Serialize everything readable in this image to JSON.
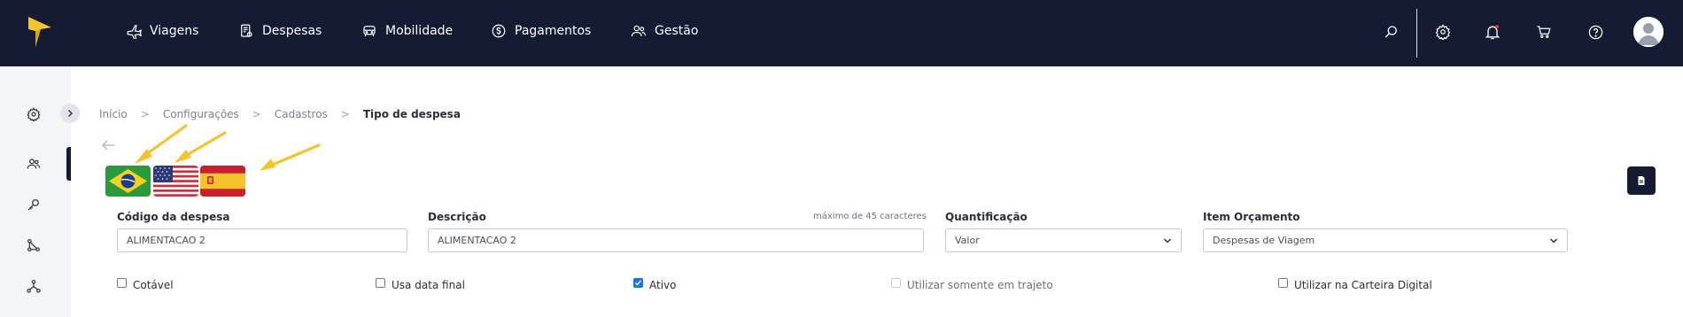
{
  "nav": {
    "items": [
      {
        "label": "Viagens",
        "icon": "airplane-icon"
      },
      {
        "label": "Despesas",
        "icon": "receipt-icon"
      },
      {
        "label": "Mobilidade",
        "icon": "car-icon"
      },
      {
        "label": "Pagamentos",
        "icon": "dollar-coin-icon"
      },
      {
        "label": "Gestão",
        "icon": "users-icon"
      }
    ],
    "right_icons": [
      "search-icon",
      "gear-icon",
      "bell-icon",
      "cart-icon",
      "help-icon",
      "avatar"
    ],
    "notification_dot_color": "#e53935"
  },
  "rail": {
    "icons": [
      "gear-icon",
      "users-icon",
      "key-icon",
      "flow-icon",
      "hierarchy-icon"
    ]
  },
  "breadcrumb": {
    "items": [
      "Início",
      "Configurações",
      "Cadastros"
    ],
    "current": "Tipo de despesa"
  },
  "languages": [
    "pt-BR",
    "en-US",
    "es-ES"
  ],
  "form": {
    "codigo": {
      "label": "Código da despesa",
      "value": "ALIMENTACAO 2"
    },
    "descricao": {
      "label": "Descrição",
      "value": "ALIMENTACAO 2",
      "hint": "máximo de 45 caracteres"
    },
    "quantificacao": {
      "label": "Quantificação",
      "value": "Valor"
    },
    "item_orcamento": {
      "label": "Item Orçamento",
      "value": "Despesas de Viagem"
    },
    "checkboxes": [
      {
        "label": "Cotável",
        "checked": false
      },
      {
        "label": "Usa data final",
        "checked": false
      },
      {
        "label": "Ativo",
        "checked": true
      },
      {
        "label": "Utilizar somente em trajeto",
        "checked": false,
        "disabled": true
      },
      {
        "label": "Utilizar na Carteira Digital",
        "checked": false
      }
    ]
  },
  "colors": {
    "topbar": "#141b33",
    "accent": "#f5c32c",
    "checkbox_on": "#1a73e8"
  }
}
